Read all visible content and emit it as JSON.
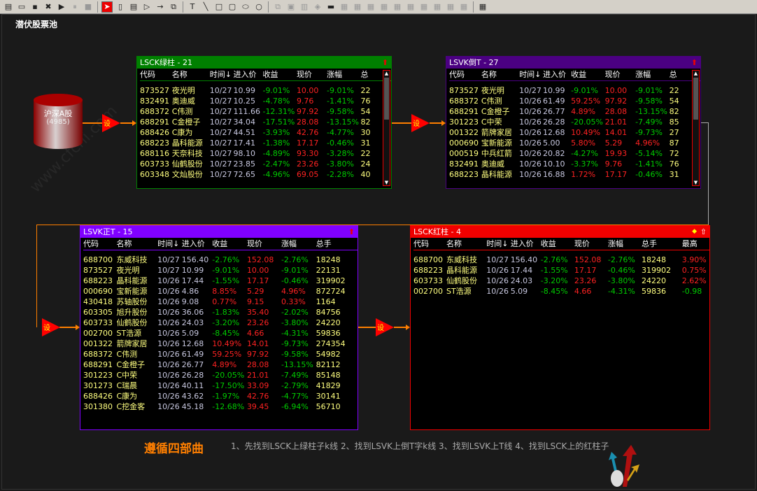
{
  "toolbar": {
    "icons": [
      "new-doc",
      "open",
      "save",
      "delete",
      "play",
      "pause",
      "stop",
      "pointer",
      "rounded-rect",
      "list",
      "triangle",
      "arrow",
      "text-box",
      "text-tool",
      "line",
      "rect",
      "round-rect",
      "ellipse",
      "circle",
      "copy",
      "paste",
      "trash",
      "fill",
      "color",
      "align-left",
      "align-right",
      "center-h",
      "align-top",
      "align-bottom",
      "center-v",
      "space-h",
      "space-v",
      "same-width",
      "same-height",
      "network"
    ]
  },
  "canvas": {
    "title": "潜伏股票池"
  },
  "source": {
    "label": "沪深A股",
    "count": "(4985)"
  },
  "filter_label": "设",
  "panels": [
    {
      "id": "green",
      "title": "LSCK绿柱 - 21",
      "color": "#008000",
      "columns": [
        "代码",
        "名称",
        "时间↓",
        "进入价",
        "收益",
        "现价",
        "涨幅",
        "总"
      ],
      "rows": [
        [
          "873527",
          "夜光明",
          "10/27",
          "10.99",
          "-9.01%",
          "10.00",
          "-9.01%",
          "22"
        ],
        [
          "832491",
          "奥迪威",
          "10/27",
          "10.25",
          "-4.78%",
          "9.76",
          "-1.41%",
          "76"
        ],
        [
          "688372",
          "C伟测",
          "10/27",
          "111.66",
          "-12.31%",
          "97.92",
          "-9.58%",
          "54"
        ],
        [
          "688291",
          "C金橙子",
          "10/27",
          "34.04",
          "-17.51%",
          "28.08",
          "-13.15%",
          "82"
        ],
        [
          "688426",
          "C康为",
          "10/27",
          "44.51",
          "-3.93%",
          "42.76",
          "-4.77%",
          "30"
        ],
        [
          "688223",
          "晶科能源",
          "10/27",
          "17.41",
          "-1.38%",
          "17.17",
          "-0.46%",
          "31"
        ],
        [
          "688116",
          "天奈科技",
          "10/27",
          "98.10",
          "-4.89%",
          "93.30",
          "-3.28%",
          "22"
        ],
        [
          "603733",
          "仙鹤股份",
          "10/27",
          "23.85",
          "-2.47%",
          "23.26",
          "-3.80%",
          "24"
        ],
        [
          "603348",
          "文灿股份",
          "10/27",
          "72.65",
          "-4.96%",
          "69.05",
          "-2.28%",
          "40"
        ]
      ]
    },
    {
      "id": "purple",
      "title": "LSVK倒T - 27",
      "color": "#4b0082",
      "columns": [
        "代码",
        "名称",
        "时间↓",
        "进入价",
        "收益",
        "现价",
        "涨幅",
        "总"
      ],
      "rows": [
        [
          "873527",
          "夜光明",
          "10/27",
          "10.99",
          "-9.01%",
          "10.00",
          "-9.01%",
          "22"
        ],
        [
          "688372",
          "C伟测",
          "10/26",
          "61.49",
          "59.25%",
          "97.92",
          "-9.58%",
          "54"
        ],
        [
          "688291",
          "C金橙子",
          "10/26",
          "26.77",
          "4.89%",
          "28.08",
          "-13.15%",
          "82"
        ],
        [
          "301223",
          "C中荣",
          "10/26",
          "26.28",
          "-20.05%",
          "21.01",
          "-7.49%",
          "85"
        ],
        [
          "001322",
          "箭牌家居",
          "10/26",
          "12.68",
          "10.49%",
          "14.01",
          "-9.73%",
          "27"
        ],
        [
          "000690",
          "宝新能源",
          "10/26",
          "5.00",
          "5.80%",
          "5.29",
          "4.96%",
          "87"
        ],
        [
          "000519",
          "中兵红箭",
          "10/26",
          "20.82",
          "-4.27%",
          "19.93",
          "-5.14%",
          "72"
        ],
        [
          "832491",
          "奥迪威",
          "10/26",
          "10.10",
          "-3.37%",
          "9.76",
          "-1.41%",
          "76"
        ],
        [
          "688223",
          "晶科能源",
          "10/26",
          "16.88",
          "1.72%",
          "17.17",
          "-0.46%",
          "31"
        ]
      ]
    },
    {
      "id": "violet",
      "title": "LSVK正T - 15",
      "color": "#8000ff",
      "columns": [
        "代码",
        "名称",
        "时间↓",
        "进入价",
        "收益",
        "现价",
        "涨幅",
        "总手"
      ],
      "rows": [
        [
          "688700",
          "东威科技",
          "10/27",
          "156.40",
          "-2.76%",
          "152.08",
          "-2.76%",
          "18248"
        ],
        [
          "873527",
          "夜光明",
          "10/27",
          "10.99",
          "-9.01%",
          "10.00",
          "-9.01%",
          "22131"
        ],
        [
          "688223",
          "晶科能源",
          "10/26",
          "17.44",
          "-1.55%",
          "17.17",
          "-0.46%",
          "319902"
        ],
        [
          "000690",
          "宝新能源",
          "10/26",
          "4.86",
          "8.85%",
          "5.29",
          "4.96%",
          "872724"
        ],
        [
          "430418",
          "苏轴股份",
          "10/26",
          "9.08",
          "0.77%",
          "9.15",
          "0.33%",
          "1164"
        ],
        [
          "603305",
          "旭升股份",
          "10/26",
          "36.06",
          "-1.83%",
          "35.40",
          "-2.02%",
          "84756"
        ],
        [
          "603733",
          "仙鹤股份",
          "10/26",
          "24.03",
          "-3.20%",
          "23.26",
          "-3.80%",
          "24220"
        ],
        [
          "002700",
          "ST浩源",
          "10/26",
          "5.09",
          "-8.45%",
          "4.66",
          "-4.31%",
          "59836"
        ],
        [
          "001322",
          "箭牌家居",
          "10/26",
          "12.68",
          "10.49%",
          "14.01",
          "-9.73%",
          "274354"
        ],
        [
          "688372",
          "C伟测",
          "10/26",
          "61.49",
          "59.25%",
          "97.92",
          "-9.58%",
          "54982"
        ],
        [
          "688291",
          "C金橙子",
          "10/26",
          "26.77",
          "4.89%",
          "28.08",
          "-13.15%",
          "82112"
        ],
        [
          "301223",
          "C中荣",
          "10/26",
          "26.28",
          "-20.05%",
          "21.01",
          "-7.49%",
          "85148"
        ],
        [
          "301273",
          "C瑞晨",
          "10/26",
          "40.11",
          "-17.50%",
          "33.09",
          "-2.79%",
          "41829"
        ],
        [
          "688426",
          "C康为",
          "10/26",
          "43.62",
          "-1.97%",
          "42.76",
          "-4.77%",
          "30141"
        ],
        [
          "301380",
          "C挖金客",
          "10/26",
          "45.18",
          "-12.68%",
          "39.45",
          "-6.94%",
          "56710"
        ]
      ]
    },
    {
      "id": "red",
      "title": "LSCK红柱 - 4",
      "color": "#f00000",
      "columns": [
        "代码",
        "名称",
        "时间↓",
        "进入价",
        "收益",
        "现价",
        "涨幅",
        "总手",
        "最高"
      ],
      "rows": [
        [
          "688700",
          "东威科技",
          "10/27",
          "156.40",
          "-2.76%",
          "152.08",
          "-2.76%",
          "18248",
          "3.90%"
        ],
        [
          "688223",
          "晶科能源",
          "10/26",
          "17.44",
          "-1.55%",
          "17.17",
          "-0.46%",
          "319902",
          "0.75%"
        ],
        [
          "603733",
          "仙鹤股份",
          "10/26",
          "24.03",
          "-3.20%",
          "23.26",
          "-3.80%",
          "24220",
          "2.62%"
        ],
        [
          "002700",
          "ST浩源",
          "10/26",
          "5.09",
          "-8.45%",
          "4.66",
          "-4.31%",
          "59836",
          "-0.98"
        ]
      ]
    }
  ],
  "footer": {
    "title": "遵循四部曲",
    "steps": "1、先找到LSCK上绿柱子k线  2、找到LSVK上倒T字k线   3、找到LSVK上T线    4、找到LSCK上的红柱子"
  }
}
